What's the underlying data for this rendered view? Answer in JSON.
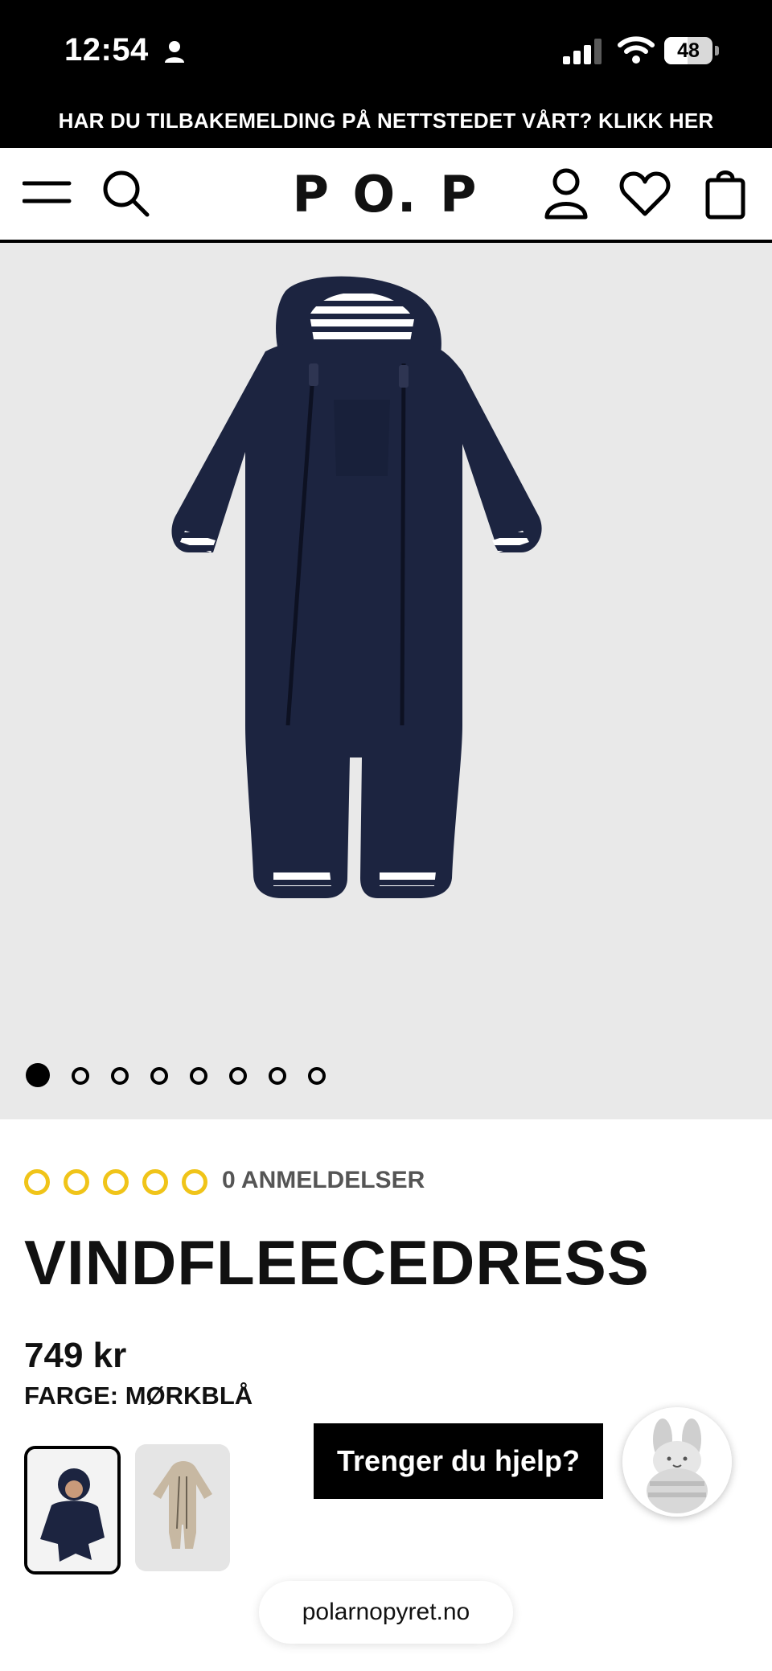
{
  "status_bar": {
    "time": "12:54",
    "battery": "48",
    "battery_level_pct": 48
  },
  "banner": {
    "text": "HAR DU TILBAKEMELDING PÅ NETTSTEDET VÅRT? KLIKK HER"
  },
  "header": {
    "logo": "P O. P"
  },
  "gallery": {
    "image_count": 8,
    "active_index": 0
  },
  "product": {
    "rating_stars": 0,
    "reviews_label": "0 ANMELDELSER",
    "title": "VINDFLEECEDRESS",
    "price": "749 kr",
    "color_label": "FARGE: MØRKBLÅ"
  },
  "chat": {
    "help_label": "Trenger du hjelp?"
  },
  "browser": {
    "url": "polarnopyret.no"
  },
  "colors": {
    "accent_star": "#f0c419",
    "navy": "#1c2440",
    "banner_bg": "#000000"
  }
}
